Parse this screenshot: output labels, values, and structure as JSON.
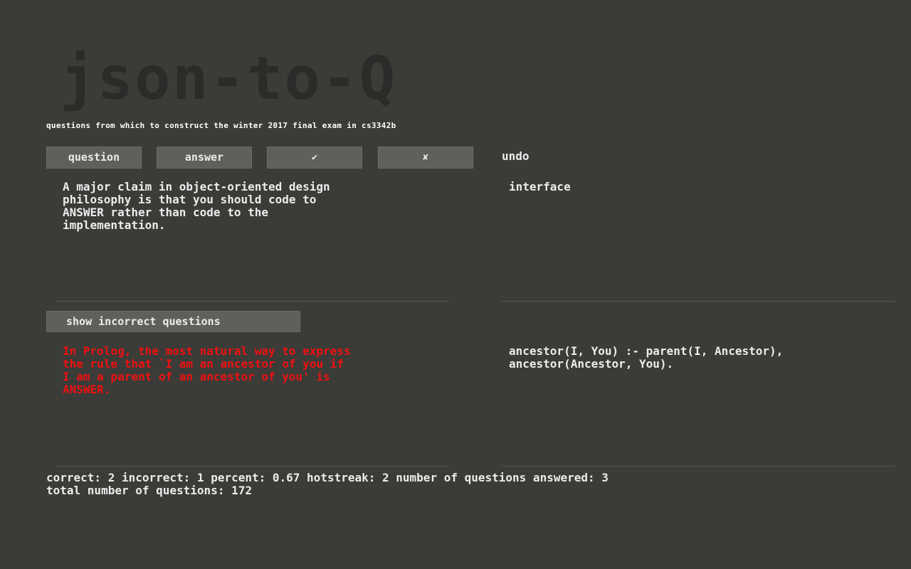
{
  "app": {
    "logo": "json-to-Q",
    "subtitle": "questions from which to construct the winter 2017 final exam in cs3342b"
  },
  "controls": {
    "question_label": "question",
    "answer_label": "answer",
    "correct_label": "✔",
    "incorrect_label": "✘",
    "undo_label": "undo"
  },
  "current": {
    "question": "A major claim in object-oriented design\nphilosophy is that you should code to\nANSWER rather than code to the\nimplementation.",
    "answer": "interface"
  },
  "incorrect_section": {
    "button_label": "show incorrect questions",
    "question": "In Prolog, the most natural way to express\nthe rule that `I am an ancestor of you if\nI am a parent of an ancestor of you' is\nANSWER.",
    "answer": "ancestor(I, You) :- parent(I, Ancestor),\nancestor(Ancestor, You)."
  },
  "stats": {
    "text": "correct: 2  incorrect: 1  percent: 0.67  hotstreak: 2  number of questions answered: 3\ntotal number of questions: 172"
  },
  "colors": {
    "background": "#3b3b38",
    "button": "#5f5f5c",
    "incorrect_text": "#ee1111",
    "logo": "#2b2b2a"
  }
}
